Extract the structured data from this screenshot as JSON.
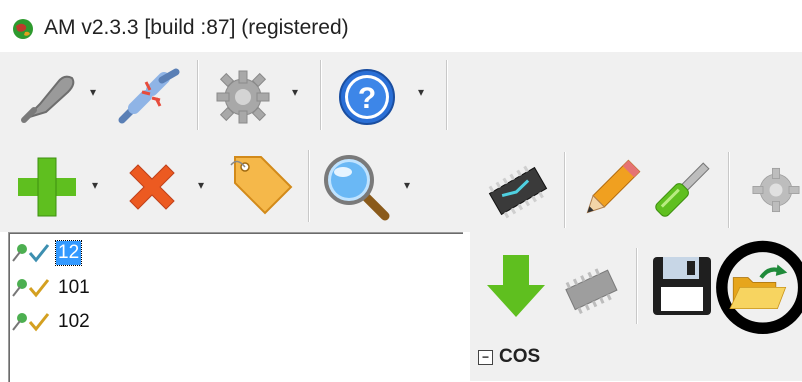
{
  "window": {
    "title": "AM v2.3.3 [build :87] (registered)"
  },
  "toolbar_top": {
    "dropdown_arrow": "▾"
  },
  "toolbar_actions": {
    "dropdown_arrow": "▾"
  },
  "tree": {
    "items": [
      {
        "label": "12",
        "selected": true
      },
      {
        "label": "101",
        "selected": false
      },
      {
        "label": "102",
        "selected": false
      }
    ]
  },
  "panel": {
    "section_label": "COS",
    "collapse_symbol": "−"
  },
  "icons": {
    "app": "globe-icon",
    "connect": "plug-icon",
    "disconnect": "plug-disconnect-icon",
    "settings": "gear-icon",
    "help": "help-icon",
    "add": "plus-icon",
    "delete": "delete-icon",
    "tag": "tag-icon",
    "search": "magnifier-icon",
    "chip": "chip-icon",
    "edit": "pencil-icon",
    "tool": "screwdriver-icon",
    "download": "download-arrow-icon",
    "chip_gray": "chip-gray-icon",
    "save": "floppy-disk-icon",
    "open": "open-folder-icon",
    "pin": "pin-icon",
    "check": "check-icon"
  },
  "colors": {
    "green": "#5fbf1f",
    "red_orange": "#ec5a21",
    "selection": "#3399ff",
    "help_blue": "#2a6fd6",
    "highlight_ring": "#000000"
  }
}
